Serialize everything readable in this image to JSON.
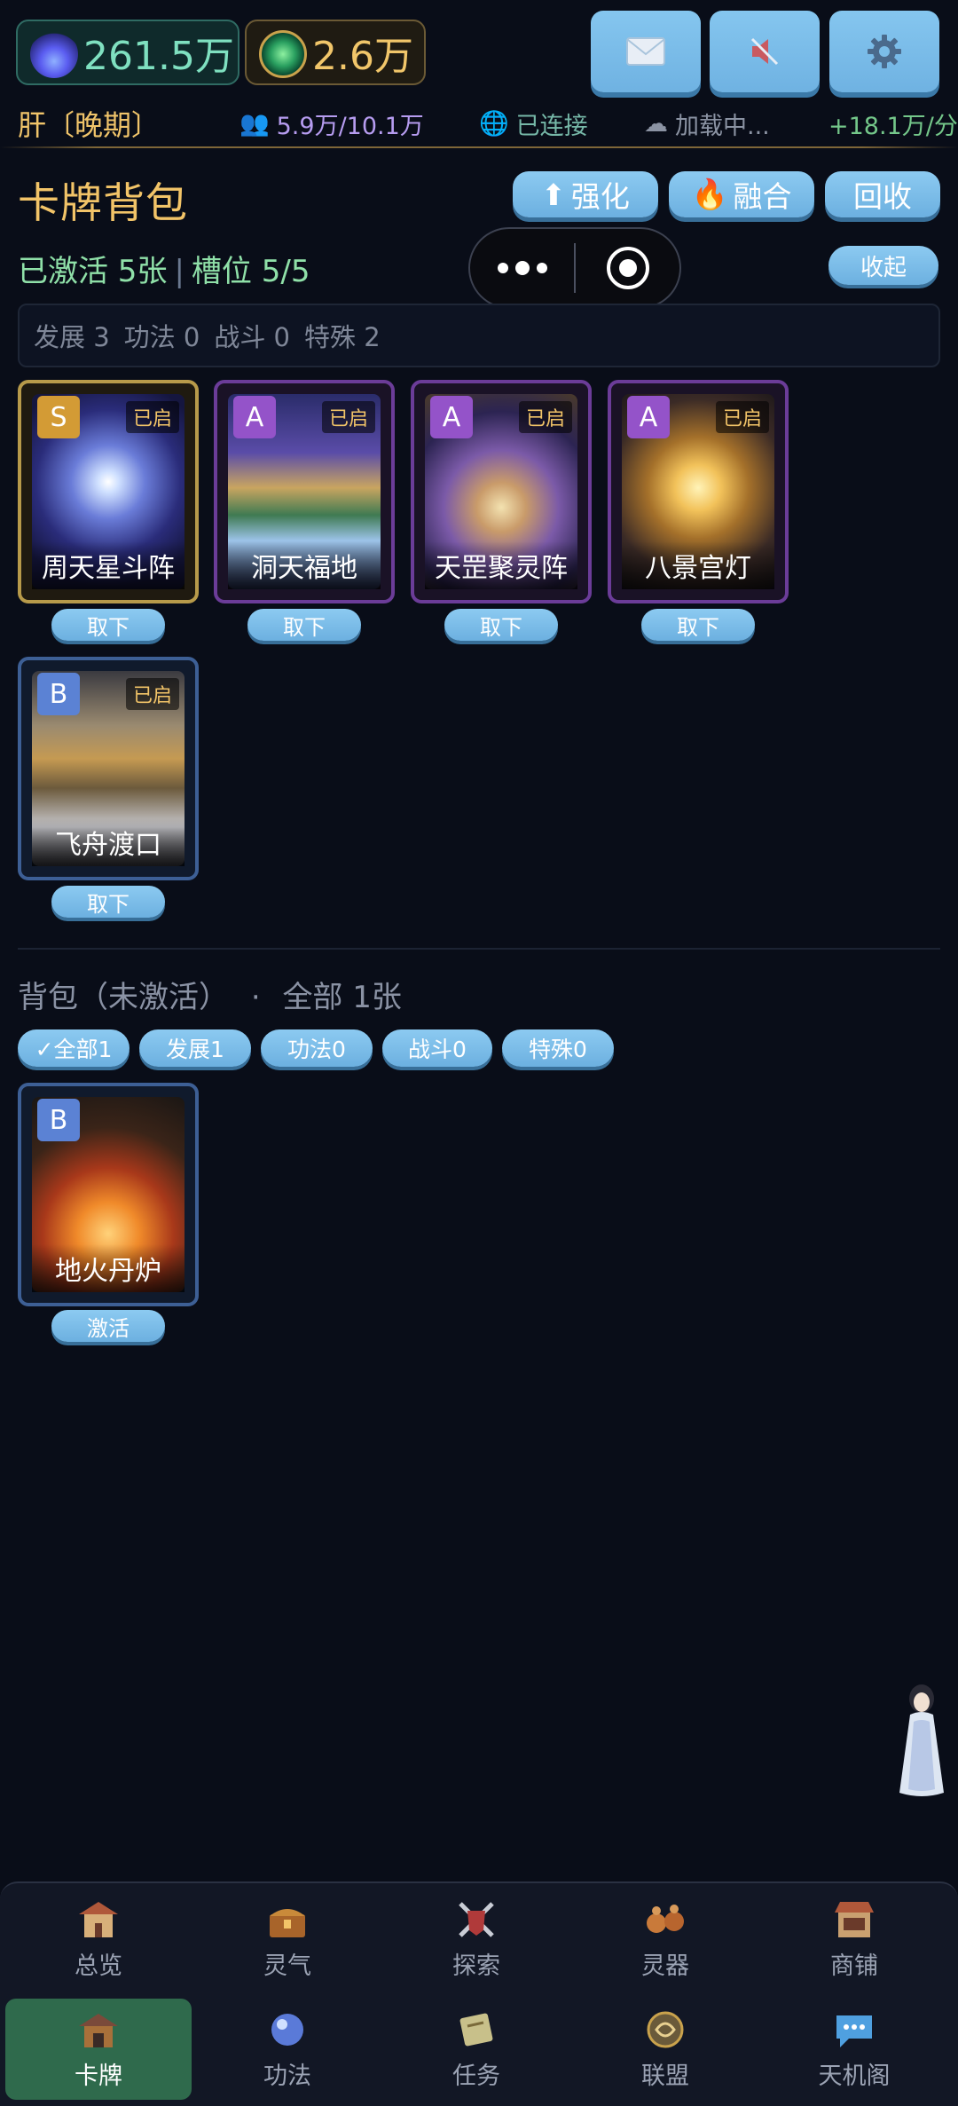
{
  "resources": [
    {
      "icon": "spirit-flame-icon",
      "value": "261.5万"
    },
    {
      "icon": "jade-coin-icon",
      "value": "2.6万"
    }
  ],
  "top_buttons": [
    {
      "icon": "mail-icon"
    },
    {
      "icon": "sound-muted-icon"
    },
    {
      "icon": "gear-icon"
    }
  ],
  "status": {
    "stage": "肝〔晚期〕",
    "people": "5.9万/10.1万",
    "connection": "已连接",
    "loading": "加载中...",
    "rate": "+18.1万/分"
  },
  "header": {
    "title": "卡牌背包",
    "enhance": "强化",
    "fuse": "融合",
    "recycle": "回收",
    "active_summary": "已激活 5张",
    "slots": "槽位 5/5",
    "collapse": "收起",
    "type_counts": [
      "发展 3",
      "功法 0",
      "战斗 0",
      "特殊 2"
    ]
  },
  "active_cards": [
    {
      "rank": "S",
      "name": "周天星斗阵",
      "tag": "已启",
      "action": "取下"
    },
    {
      "rank": "A",
      "name": "洞天福地",
      "tag": "已启",
      "action": "取下"
    },
    {
      "rank": "A",
      "name": "天罡聚灵阵",
      "tag": "已启",
      "action": "取下"
    },
    {
      "rank": "A",
      "name": "八景宫灯",
      "tag": "已启",
      "action": "取下"
    },
    {
      "rank": "B",
      "name": "飞舟渡口",
      "tag": "已启",
      "action": "取下"
    }
  ],
  "bag": {
    "title": "背包（未激活）",
    "dot": "·",
    "total": "全部 1张",
    "filters": [
      "✓全部1",
      "发展1",
      "功法0",
      "战斗0",
      "特殊0"
    ],
    "cards": [
      {
        "rank": "B",
        "name": "地火丹炉",
        "action": "激活"
      }
    ]
  },
  "nav": {
    "row1": [
      "总览",
      "灵气",
      "探索",
      "灵器",
      "商铺"
    ],
    "row2": [
      "卡牌",
      "功法",
      "任务",
      "联盟",
      "天机阁"
    ],
    "active": "卡牌"
  },
  "colors": {
    "background": "#090d18",
    "gold": "#f2c468",
    "button_blue": "#7bbde8",
    "active_green": "#8fe0a8",
    "nav_active": "#2f6a4c"
  }
}
